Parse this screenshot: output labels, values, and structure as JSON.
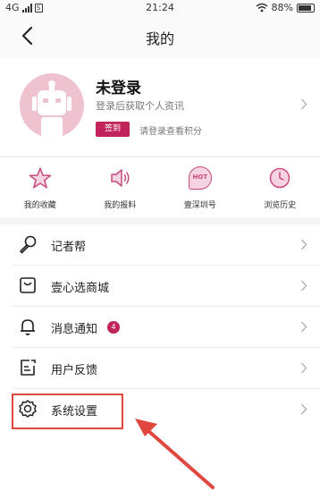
{
  "status": {
    "network": "4G",
    "sim": "S",
    "time": "21:24",
    "battery": "88%",
    "battery_level": 0.88
  },
  "nav": {
    "title": "我的"
  },
  "profile": {
    "name": "未登录",
    "subtitle": "登录后获取个人资讯",
    "signin_label": "签到",
    "hint": "请登录查看积分"
  },
  "shortcuts": [
    {
      "label": "我的收藏",
      "icon": "star-icon"
    },
    {
      "label": "我的报料",
      "icon": "speaker-icon"
    },
    {
      "label": "壹深圳号",
      "icon": "hot-icon",
      "icon_text": "HOT"
    },
    {
      "label": "浏览历史",
      "icon": "clock-icon"
    }
  ],
  "menu": [
    {
      "label": "记者帮",
      "icon": "microphone-icon"
    },
    {
      "label": "壹心选商城",
      "icon": "shopping-bag-icon"
    },
    {
      "label": "消息通知",
      "icon": "bell-icon",
      "badge": "4"
    },
    {
      "label": "用户反馈",
      "icon": "feedback-icon"
    },
    {
      "label": "系统设置",
      "icon": "settings-icon"
    }
  ],
  "colors": {
    "accent": "#c0245a",
    "icon_pink": "#c74b7e",
    "annotation_red": "#e0483f",
    "avatar_bg": "#eec3cf"
  }
}
